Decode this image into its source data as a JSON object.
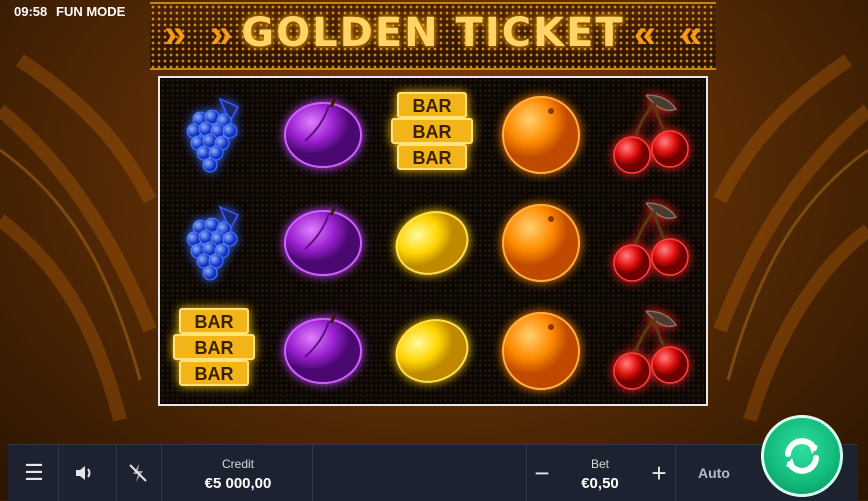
{
  "status": {
    "time": "09:58",
    "mode": "FUN MODE"
  },
  "game": {
    "title": "GOLDEN TICKET"
  },
  "reels": [
    [
      "grapes",
      "grapes",
      "bar"
    ],
    [
      "plum",
      "plum",
      "plum"
    ],
    [
      "bar",
      "lemon",
      "lemon"
    ],
    [
      "orange",
      "orange",
      "orange"
    ],
    [
      "cherries",
      "cherries",
      "cherries"
    ]
  ],
  "symbols": {
    "bar_text": "BAR"
  },
  "colors": {
    "accent_gold": "#ffd466",
    "spin_green": "#12b87a",
    "bar_bg": "#1d2230"
  },
  "controls": {
    "menu_icon": "menu-icon",
    "sound_icon": "speaker-icon",
    "turbo_icon": "turbo-off-icon",
    "credit_label": "Credit",
    "credit_value": "€5 000,00",
    "bet_label": "Bet",
    "bet_value": "€0,50",
    "bet_minus": "−",
    "bet_plus": "+",
    "auto_label": "Auto",
    "spin_icon": "refresh-icon"
  }
}
